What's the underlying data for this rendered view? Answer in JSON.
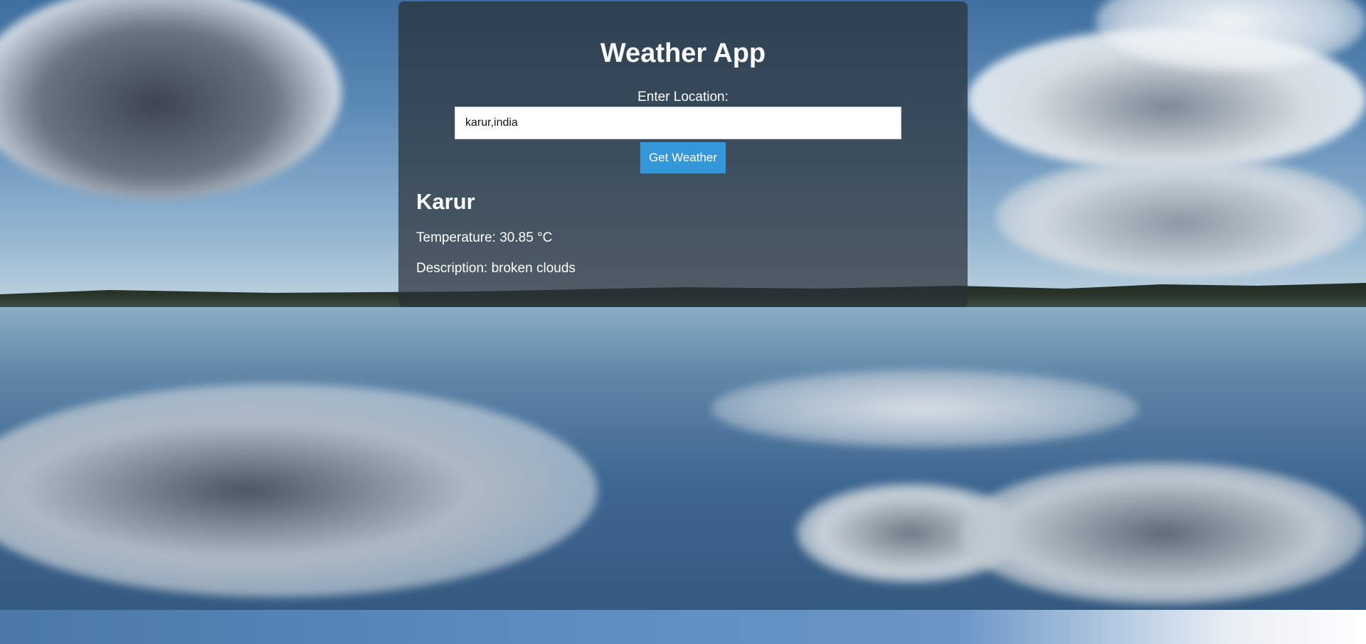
{
  "app": {
    "title": "Weather App"
  },
  "form": {
    "location_label": "Enter Location:",
    "location_value": "karur,india",
    "submit_label": "Get Weather"
  },
  "result": {
    "city": "Karur",
    "temperature_text": "Temperature: 30.85 °C",
    "description_text": "Description: broken clouds"
  },
  "colors": {
    "button": "#3498db",
    "panel": "rgba(40, 48, 56, 0.72)",
    "text": "#ffffff"
  }
}
